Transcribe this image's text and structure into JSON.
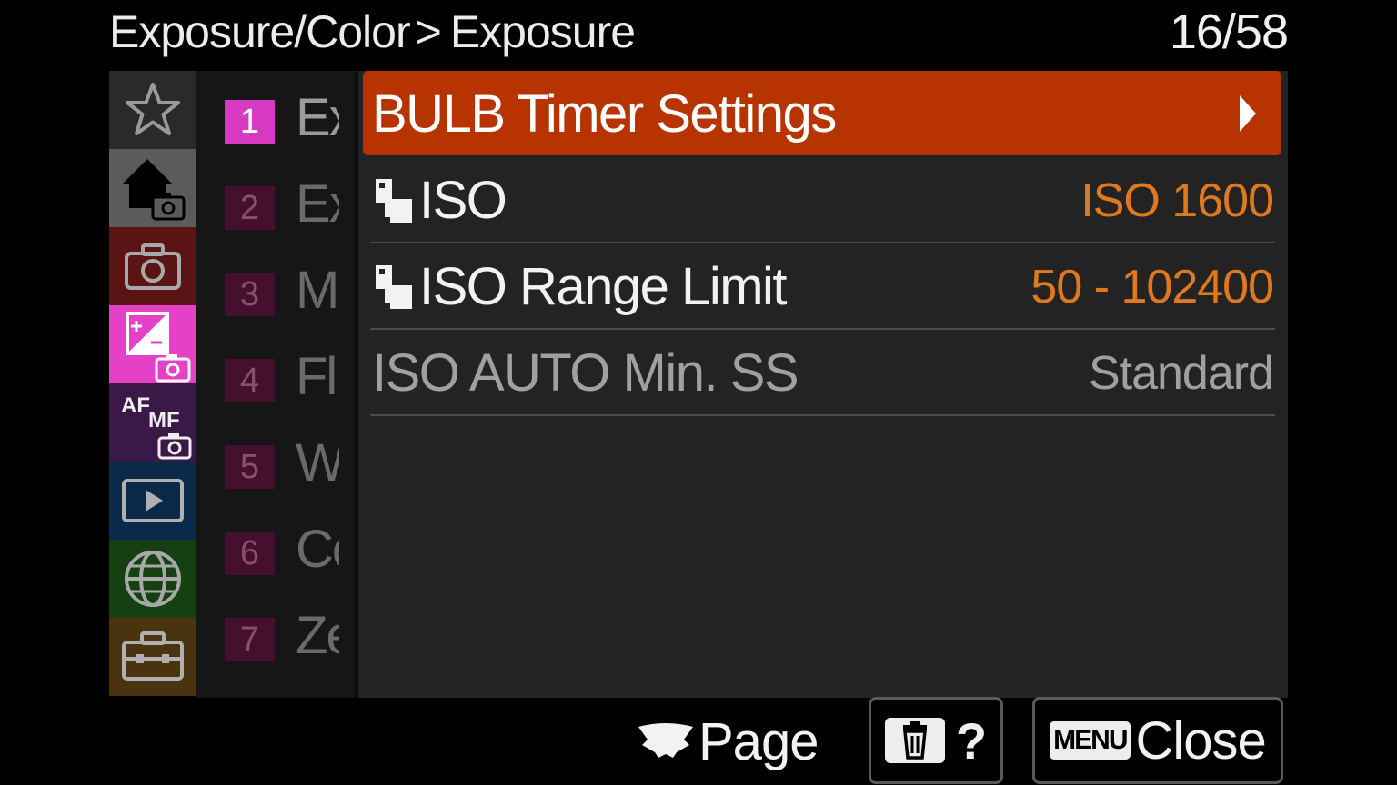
{
  "header": {
    "breadcrumb_parent": "Exposure/Color",
    "breadcrumb_separator": ">",
    "breadcrumb_current": "Exposure",
    "page_counter": "16/58"
  },
  "categories": [
    {
      "icon": "star-icon",
      "color": "#2a2a2a"
    },
    {
      "icon": "home-camera-icon",
      "color": "#5b5b5b"
    },
    {
      "icon": "camera-icon",
      "color": "#5a1414"
    },
    {
      "icon": "exposure-camera-icon",
      "color": "#e441c7",
      "active": true
    },
    {
      "icon": "af-mf-camera-icon",
      "color": "#3a1848",
      "text_af": "AF",
      "text_mf": "MF"
    },
    {
      "icon": "playback-icon",
      "color": "#0b2a4a"
    },
    {
      "icon": "globe-icon",
      "color": "#154012"
    },
    {
      "icon": "toolbox-icon",
      "color": "#4a3410"
    }
  ],
  "tabs": [
    {
      "num": "1",
      "label": "Ex",
      "active": true
    },
    {
      "num": "2",
      "label": "Ex"
    },
    {
      "num": "3",
      "label": "M"
    },
    {
      "num": "4",
      "label": "Fl"
    },
    {
      "num": "5",
      "label": "W"
    },
    {
      "num": "6",
      "label": "Co"
    },
    {
      "num": "7",
      "label": "Ze"
    }
  ],
  "menu_items": [
    {
      "label": "BULB Timer Settings",
      "selected": true
    },
    {
      "label": "ISO",
      "value": "ISO 1600",
      "icon": "still-movie-icon"
    },
    {
      "label": "ISO Range Limit",
      "value": "50 - 102400",
      "icon": "still-movie-icon"
    },
    {
      "label": "ISO AUTO Min. SS",
      "value": "Standard",
      "disabled": true
    }
  ],
  "footer": {
    "page_label": "Page",
    "help_label": "?",
    "menu_badge": "MENU",
    "close_label": "Close"
  },
  "colors": {
    "selected_row": "#b73300",
    "value_text": "#e0791e",
    "active_tab": "#d63ac0"
  }
}
